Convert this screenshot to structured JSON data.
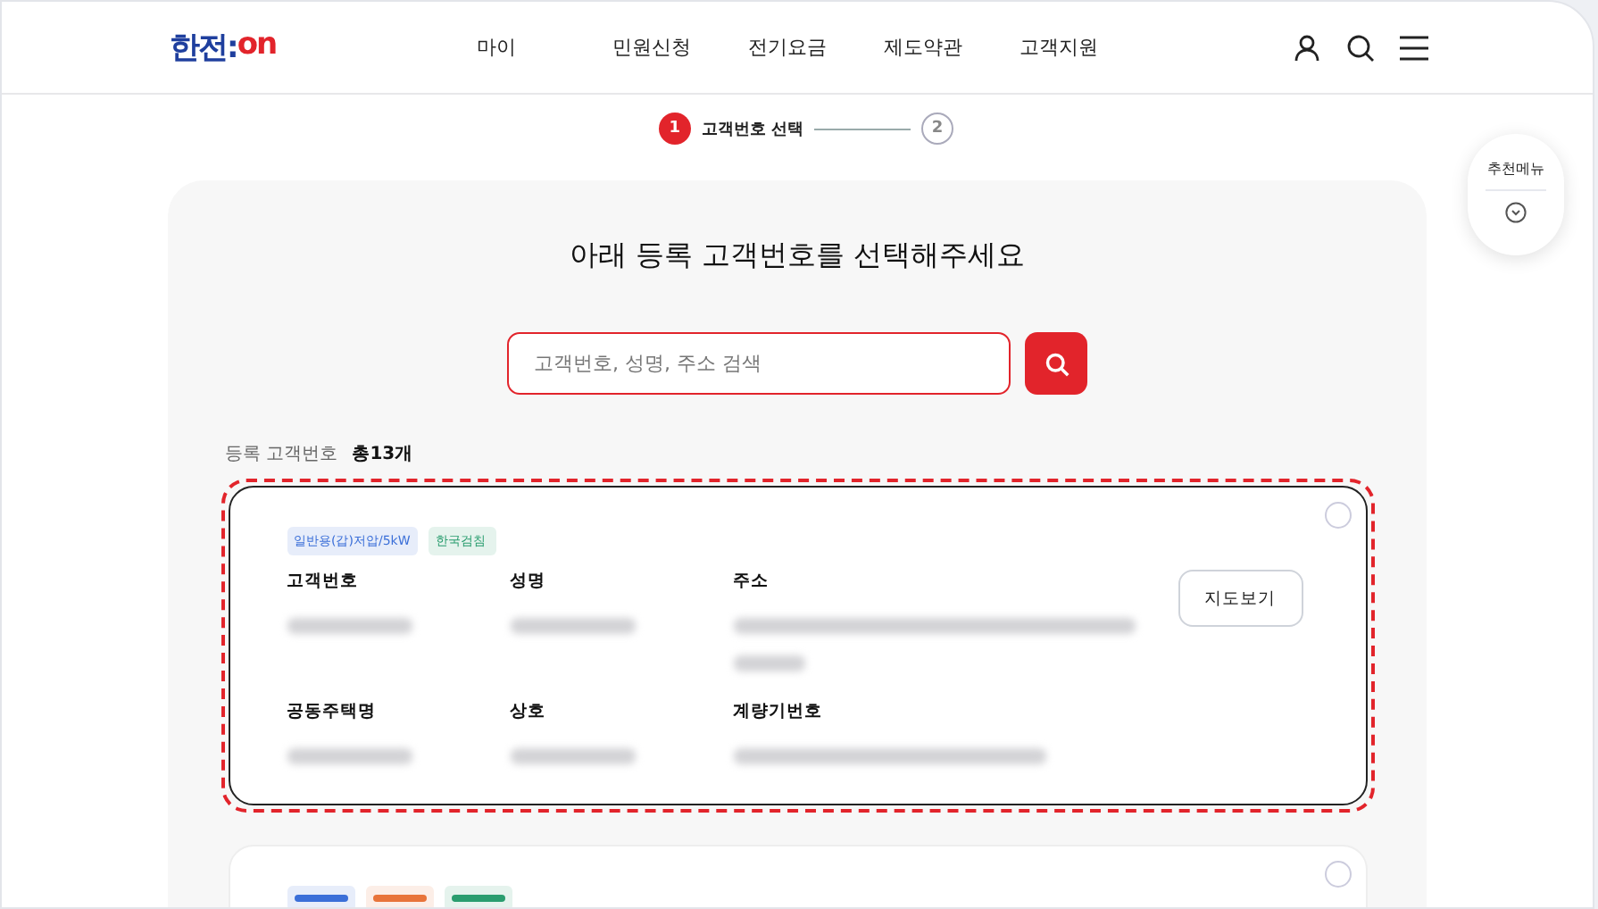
{
  "header": {
    "logo": {
      "prefix": "한전:",
      "suffix": "on"
    },
    "nav": [
      "마이",
      "민원신청",
      "전기요금",
      "제도약관",
      "고객지원"
    ]
  },
  "stepper": [
    {
      "number": "1",
      "label": "고객번호 선택",
      "selected": true
    },
    {
      "number": "2",
      "selected": false
    }
  ],
  "floating_menu": {
    "label": "추천메뉴"
  },
  "title": "아래 등록 고객번호를 선택해주세요",
  "search": {
    "placeholder": "고객번호, 성명, 주소 검색"
  },
  "list_header": {
    "label": "등록 고객번호",
    "count": "총13개"
  },
  "cards": [
    {
      "selected": true,
      "tags": [
        {
          "label": "일반용(갑)저압/5kW",
          "color": "#3b6fd8"
        },
        {
          "label": "한국검침",
          "color": "#2a9d6f"
        }
      ],
      "fields": [
        {
          "label": "고객번호",
          "kind": "short"
        },
        {
          "label": "성명",
          "kind": "short"
        },
        {
          "label": "주소",
          "kind": "multiline"
        },
        {
          "label": "공동주택명",
          "kind": "short"
        },
        {
          "label": "상호",
          "kind": "short"
        },
        {
          "label": "계량기번호",
          "kind": "long"
        }
      ],
      "map_button": "지도보기"
    },
    {
      "selected": false,
      "tags": [
        {
          "color": "#3b6fd8"
        },
        {
          "color": "#e8743a"
        },
        {
          "color": "#2a9d6f"
        }
      ]
    }
  ]
}
